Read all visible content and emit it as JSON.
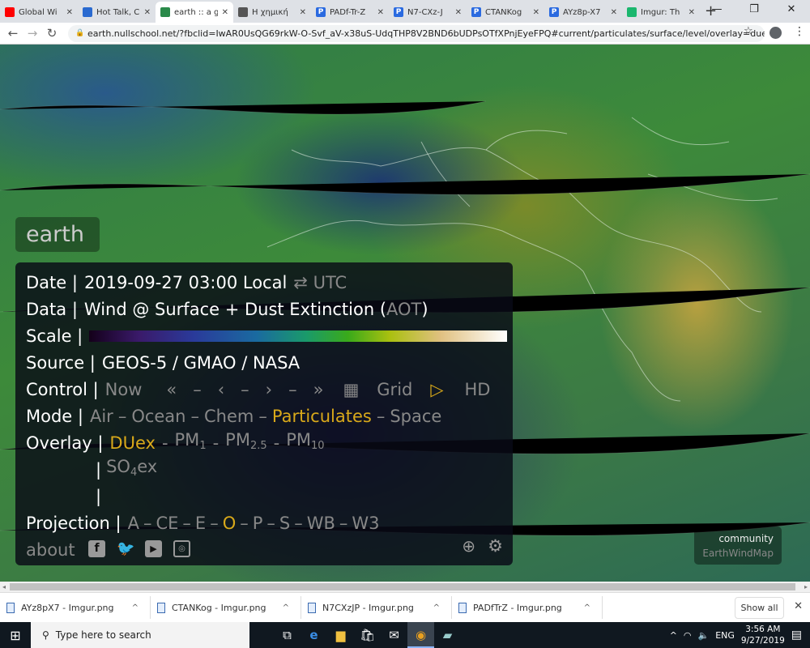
{
  "browser": {
    "tabs": [
      {
        "title": "Global Wi",
        "icon": "youtube-icon",
        "color": "#ff0000"
      },
      {
        "title": "Hot Talk, C",
        "icon": "figure-icon",
        "color": "#2a6ad0"
      },
      {
        "title": "earth :: a g",
        "icon": "earth-icon",
        "color": "#2a8a4a",
        "active": true
      },
      {
        "title": "Η χημική",
        "icon": "globe-icon",
        "color": "#555555"
      },
      {
        "title": "PADf-Tr-Z",
        "icon": "p-icon",
        "color": "#2a6ae0"
      },
      {
        "title": "N7-CXz-J",
        "icon": "p-icon",
        "color": "#2a6ae0"
      },
      {
        "title": "CTANKog",
        "icon": "p-icon",
        "color": "#2a6ae0"
      },
      {
        "title": "AYz8p-X7",
        "icon": "p-icon",
        "color": "#2a6ae0"
      },
      {
        "title": "Imgur: Th",
        "icon": "imgur-icon",
        "color": "#1bb76e"
      }
    ],
    "url": "earth.nullschool.net/?fbclid=IwAR0UsQG69rkW-O-Svf_aV-x38uS-UdqTHP8V2BND6bUDPsOTfXPnjEyeFPQ#current/particulates/surface/level/overlay=duexttau/orth..."
  },
  "earth": {
    "logo": "earth",
    "date_label": "Date |",
    "date": "2019-09-27 03:00 Local",
    "utc_toggle": "⇄ UTC",
    "data_label": "Data |",
    "data": "Wind @ Surface + Dust Extinction (",
    "data_aot": "AOT",
    "data_end": ")",
    "scale_label": "Scale |",
    "source_label": "Source |",
    "source": "GEOS-5 / GMAO / NASA",
    "control_label": "Control |",
    "control": {
      "now": "Now",
      "back3": "«",
      "sep": "–",
      "back1": "‹",
      "fwd1": "›",
      "fwd3": "»",
      "grid": "Grid",
      "hd": "HD"
    },
    "mode_label": "Mode |",
    "modes": [
      "Air",
      "Ocean",
      "Chem",
      "Particulates",
      "Space"
    ],
    "active_mode": "Particulates",
    "overlay_label": "Overlay |",
    "overlays": {
      "duex": "DUex",
      "pm": "PM",
      "pm1": "1",
      "pm25": "2.5",
      "pm10": "10",
      "so4": "SO",
      "so4sub": "4",
      "so4end": "ex"
    },
    "projection_label": "Projection |",
    "projections": [
      "A",
      "CE",
      "E",
      "O",
      "P",
      "S",
      "WB",
      "W3"
    ],
    "active_projection": "O",
    "about": "about",
    "accent": "#d9a91a",
    "community": "community",
    "community_link": "EarthWindMap"
  },
  "downloads": [
    {
      "name": "AYz8pX7 - Imgur.png"
    },
    {
      "name": "CTANKog - Imgur.png"
    },
    {
      "name": "N7CXzJP - Imgur.png"
    },
    {
      "name": "PADfTrZ - Imgur.png"
    }
  ],
  "show_all": "Show all",
  "taskbar": {
    "search_placeholder": "Type here to search",
    "lang": "ENG",
    "time": "3:56 AM",
    "date": "9/27/2019"
  }
}
